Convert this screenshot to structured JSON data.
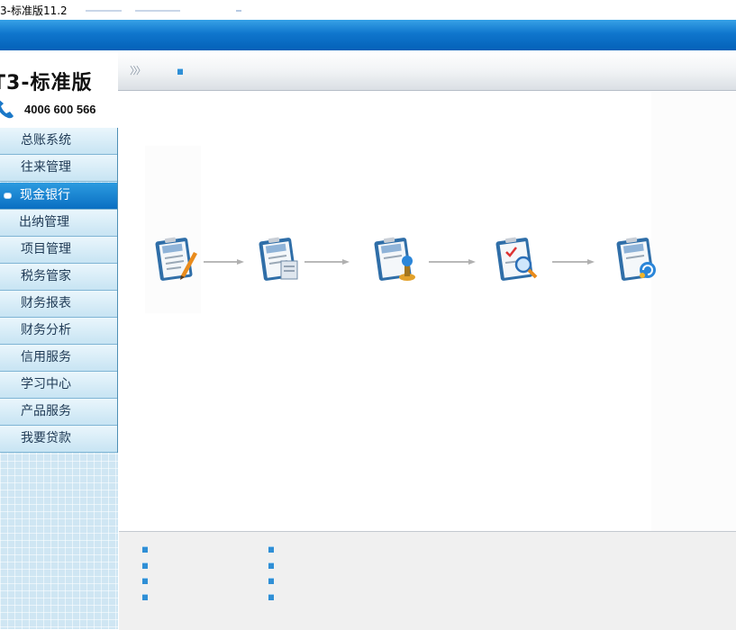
{
  "window": {
    "title": "3-标准版11.2"
  },
  "logo": {
    "brand": "T3-标准版",
    "phone": "4006 600 566"
  },
  "sidebar": {
    "items": [
      {
        "label": "总账系统",
        "active": false
      },
      {
        "label": "往来管理",
        "active": false
      },
      {
        "label": "现金银行",
        "active": true
      },
      {
        "label": "出纳管理",
        "active": false
      },
      {
        "label": "项目管理",
        "active": false
      },
      {
        "label": "税务管家",
        "active": false
      },
      {
        "label": "财务报表",
        "active": false
      },
      {
        "label": "财务分析",
        "active": false
      },
      {
        "label": "信用服务",
        "active": false
      },
      {
        "label": "学习中心",
        "active": false
      },
      {
        "label": "产品服务",
        "active": false
      },
      {
        "label": "我要贷款",
        "active": false
      }
    ]
  },
  "breadcrumb": {
    "arrows": "〉〉〉"
  },
  "flow": {
    "steps": [
      {
        "icon": "bank-form-edit-icon"
      },
      {
        "icon": "bank-form-copy-icon"
      },
      {
        "icon": "bank-form-stamp-icon"
      },
      {
        "icon": "bank-form-search-icon"
      },
      {
        "icon": "bank-form-refresh-icon"
      }
    ]
  },
  "colors": {
    "accent_blue": "#0a6fc2",
    "menu_text": "#1f3a55"
  }
}
